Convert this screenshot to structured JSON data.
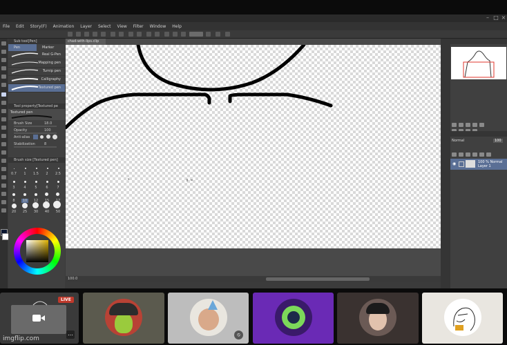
{
  "menu": [
    "File",
    "Edit",
    "Story(F)",
    "Animation",
    "Layer",
    "Select",
    "View",
    "Filter",
    "Window",
    "Help"
  ],
  "left_panel": {
    "subtool_header": "Sub tool[Pen]",
    "tabs": [
      "Pen",
      "Marker"
    ],
    "brushes": [
      "Real G-Pen",
      "Mapping pen",
      "Turnip pen",
      "Calligraphy",
      "Textured pen"
    ],
    "tool_property_header": "Tool property[Textured pe",
    "tool_name": "Textured pen",
    "props": [
      {
        "label": "Brush Size",
        "value": "18.0"
      },
      {
        "label": "Opacity",
        "value": "100"
      },
      {
        "label": "Anti-alias",
        "value": ""
      },
      {
        "label": "Stabilization",
        "value": "8"
      }
    ],
    "brush_size_header": "Brush size [Textured pen]",
    "sizes": [
      "0.7",
      "1",
      "1.5",
      "2",
      "2.5",
      "3",
      "4",
      "5",
      "6",
      "7",
      "8",
      "10",
      "12",
      "15",
      "17",
      "20",
      "25",
      "30",
      "40",
      "50"
    ]
  },
  "document": {
    "tab": "chad-with-lips.clip",
    "zoom": "100.0"
  },
  "right_panel": {
    "blend": "Normal",
    "opacity": "100",
    "layer_label": "100 % Normal",
    "layer_name": "Layer 1"
  },
  "call": {
    "live_badge": "LIVE",
    "watermark": "imgflip.com"
  }
}
